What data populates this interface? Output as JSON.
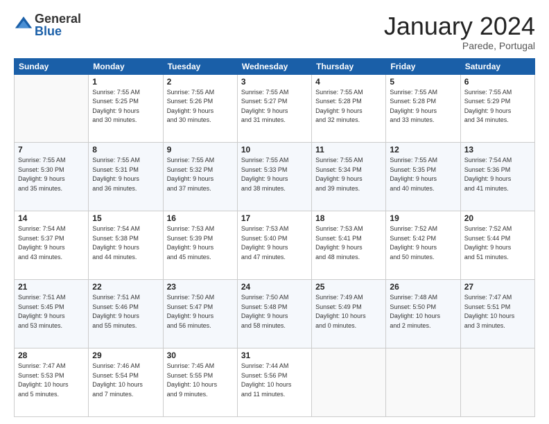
{
  "header": {
    "logo_general": "General",
    "logo_blue": "Blue",
    "month": "January 2024",
    "location": "Parede, Portugal"
  },
  "days_of_week": [
    "Sunday",
    "Monday",
    "Tuesday",
    "Wednesday",
    "Thursday",
    "Friday",
    "Saturday"
  ],
  "weeks": [
    [
      {
        "day": "",
        "info": ""
      },
      {
        "day": "1",
        "info": "Sunrise: 7:55 AM\nSunset: 5:25 PM\nDaylight: 9 hours\nand 30 minutes."
      },
      {
        "day": "2",
        "info": "Sunrise: 7:55 AM\nSunset: 5:26 PM\nDaylight: 9 hours\nand 30 minutes."
      },
      {
        "day": "3",
        "info": "Sunrise: 7:55 AM\nSunset: 5:27 PM\nDaylight: 9 hours\nand 31 minutes."
      },
      {
        "day": "4",
        "info": "Sunrise: 7:55 AM\nSunset: 5:28 PM\nDaylight: 9 hours\nand 32 minutes."
      },
      {
        "day": "5",
        "info": "Sunrise: 7:55 AM\nSunset: 5:28 PM\nDaylight: 9 hours\nand 33 minutes."
      },
      {
        "day": "6",
        "info": "Sunrise: 7:55 AM\nSunset: 5:29 PM\nDaylight: 9 hours\nand 34 minutes."
      }
    ],
    [
      {
        "day": "7",
        "info": "Sunrise: 7:55 AM\nSunset: 5:30 PM\nDaylight: 9 hours\nand 35 minutes."
      },
      {
        "day": "8",
        "info": "Sunrise: 7:55 AM\nSunset: 5:31 PM\nDaylight: 9 hours\nand 36 minutes."
      },
      {
        "day": "9",
        "info": "Sunrise: 7:55 AM\nSunset: 5:32 PM\nDaylight: 9 hours\nand 37 minutes."
      },
      {
        "day": "10",
        "info": "Sunrise: 7:55 AM\nSunset: 5:33 PM\nDaylight: 9 hours\nand 38 minutes."
      },
      {
        "day": "11",
        "info": "Sunrise: 7:55 AM\nSunset: 5:34 PM\nDaylight: 9 hours\nand 39 minutes."
      },
      {
        "day": "12",
        "info": "Sunrise: 7:55 AM\nSunset: 5:35 PM\nDaylight: 9 hours\nand 40 minutes."
      },
      {
        "day": "13",
        "info": "Sunrise: 7:54 AM\nSunset: 5:36 PM\nDaylight: 9 hours\nand 41 minutes."
      }
    ],
    [
      {
        "day": "14",
        "info": "Sunrise: 7:54 AM\nSunset: 5:37 PM\nDaylight: 9 hours\nand 43 minutes."
      },
      {
        "day": "15",
        "info": "Sunrise: 7:54 AM\nSunset: 5:38 PM\nDaylight: 9 hours\nand 44 minutes."
      },
      {
        "day": "16",
        "info": "Sunrise: 7:53 AM\nSunset: 5:39 PM\nDaylight: 9 hours\nand 45 minutes."
      },
      {
        "day": "17",
        "info": "Sunrise: 7:53 AM\nSunset: 5:40 PM\nDaylight: 9 hours\nand 47 minutes."
      },
      {
        "day": "18",
        "info": "Sunrise: 7:53 AM\nSunset: 5:41 PM\nDaylight: 9 hours\nand 48 minutes."
      },
      {
        "day": "19",
        "info": "Sunrise: 7:52 AM\nSunset: 5:42 PM\nDaylight: 9 hours\nand 50 minutes."
      },
      {
        "day": "20",
        "info": "Sunrise: 7:52 AM\nSunset: 5:44 PM\nDaylight: 9 hours\nand 51 minutes."
      }
    ],
    [
      {
        "day": "21",
        "info": "Sunrise: 7:51 AM\nSunset: 5:45 PM\nDaylight: 9 hours\nand 53 minutes."
      },
      {
        "day": "22",
        "info": "Sunrise: 7:51 AM\nSunset: 5:46 PM\nDaylight: 9 hours\nand 55 minutes."
      },
      {
        "day": "23",
        "info": "Sunrise: 7:50 AM\nSunset: 5:47 PM\nDaylight: 9 hours\nand 56 minutes."
      },
      {
        "day": "24",
        "info": "Sunrise: 7:50 AM\nSunset: 5:48 PM\nDaylight: 9 hours\nand 58 minutes."
      },
      {
        "day": "25",
        "info": "Sunrise: 7:49 AM\nSunset: 5:49 PM\nDaylight: 10 hours\nand 0 minutes."
      },
      {
        "day": "26",
        "info": "Sunrise: 7:48 AM\nSunset: 5:50 PM\nDaylight: 10 hours\nand 2 minutes."
      },
      {
        "day": "27",
        "info": "Sunrise: 7:47 AM\nSunset: 5:51 PM\nDaylight: 10 hours\nand 3 minutes."
      }
    ],
    [
      {
        "day": "28",
        "info": "Sunrise: 7:47 AM\nSunset: 5:53 PM\nDaylight: 10 hours\nand 5 minutes."
      },
      {
        "day": "29",
        "info": "Sunrise: 7:46 AM\nSunset: 5:54 PM\nDaylight: 10 hours\nand 7 minutes."
      },
      {
        "day": "30",
        "info": "Sunrise: 7:45 AM\nSunset: 5:55 PM\nDaylight: 10 hours\nand 9 minutes."
      },
      {
        "day": "31",
        "info": "Sunrise: 7:44 AM\nSunset: 5:56 PM\nDaylight: 10 hours\nand 11 minutes."
      },
      {
        "day": "",
        "info": ""
      },
      {
        "day": "",
        "info": ""
      },
      {
        "day": "",
        "info": ""
      }
    ]
  ]
}
